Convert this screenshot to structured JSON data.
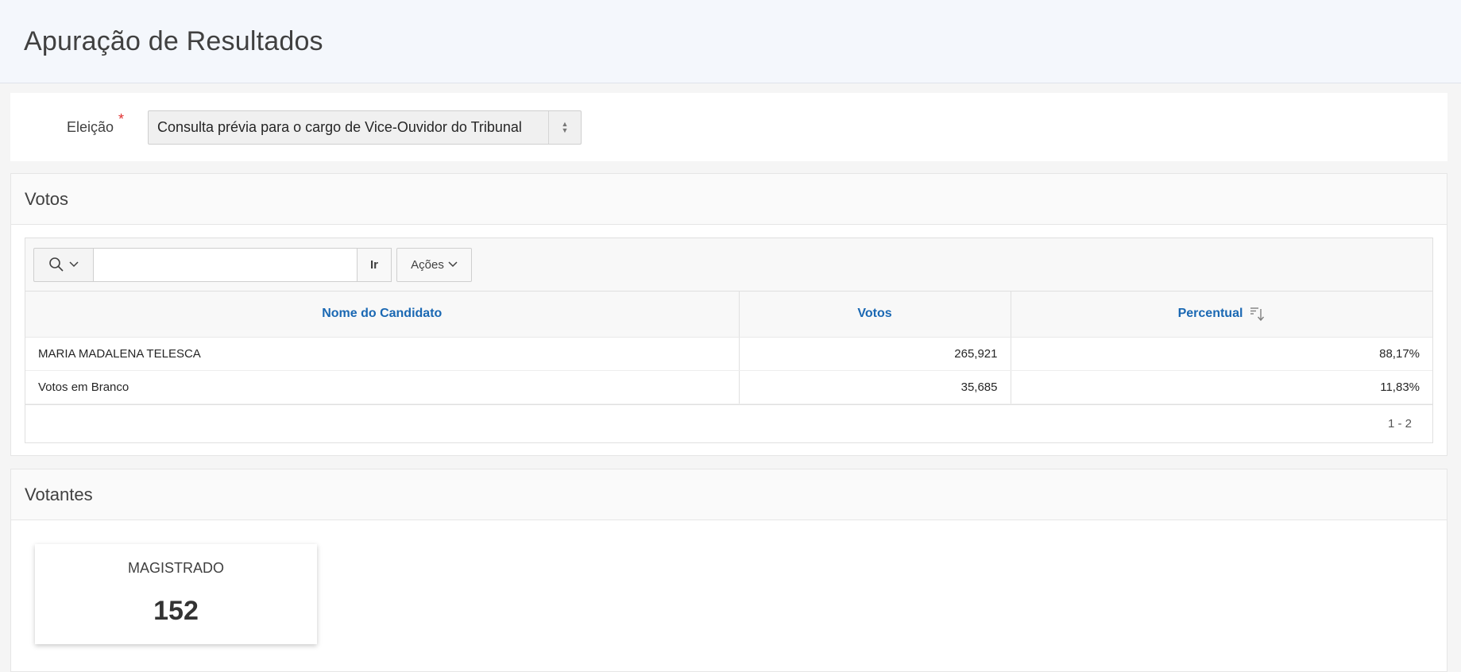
{
  "header": {
    "title": "Apuração de Resultados"
  },
  "form": {
    "label": "Eleição",
    "required_mark": "*",
    "select_value": "Consulta prévia para o cargo de Vice-Ouvidor do Tribunal"
  },
  "votos": {
    "title": "Votos",
    "search": {
      "placeholder": "",
      "go_label": "Ir",
      "actions_label": "Ações"
    },
    "columns": [
      "Nome do Candidato",
      "Votos",
      "Percentual"
    ],
    "rows": [
      {
        "nome": "MARIA MADALENA TELESCA",
        "votos": "265,921",
        "percentual": "88,17%"
      },
      {
        "nome": "Votos em Branco",
        "votos": "35,685",
        "percentual": "11,83%"
      }
    ],
    "pagination": "1 - 2"
  },
  "votantes": {
    "title": "Votantes",
    "cards": [
      {
        "label": "MAGISTRADO",
        "value": "152"
      }
    ]
  },
  "colors": {
    "link": "#1a68b3",
    "required": "#e02f2f",
    "header_bg": "#f4f7fc"
  }
}
